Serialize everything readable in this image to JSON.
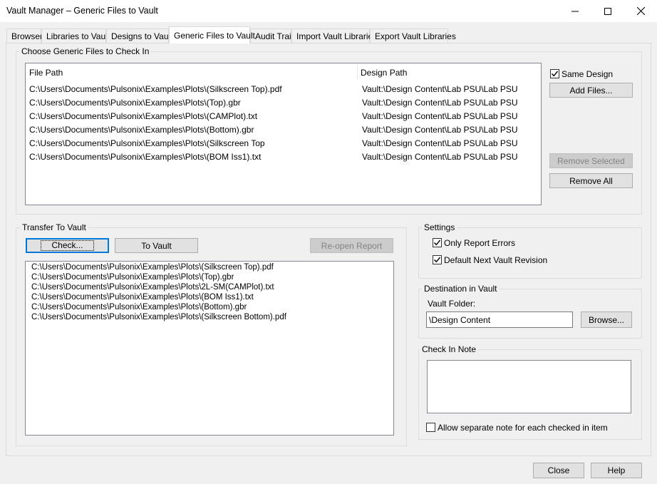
{
  "window": {
    "title": "Vault Manager – Generic Files to Vault",
    "minimize_glyph": "—",
    "maximize_glyph": "☐",
    "close_glyph": "✕"
  },
  "tabs": [
    {
      "label": "Browser",
      "active": false
    },
    {
      "label": "Libraries to Vault",
      "active": false
    },
    {
      "label": "Designs to Vault",
      "active": false
    },
    {
      "label": "Generic Files to Vault",
      "active": true
    },
    {
      "label": "Audit Trail",
      "active": false
    },
    {
      "label": "Import Vault Libraries",
      "active": false
    },
    {
      "label": "Export Vault Libraries",
      "active": false
    }
  ],
  "choose": {
    "group_label": "Choose Generic Files to Check In",
    "col_file_path": "File Path",
    "col_design_path": "Design Path",
    "rows": [
      {
        "file": "C:\\Users\\Documents\\Pulsonix\\Examples\\Plots\\(Silkscreen Top).pdf",
        "design": "Vault:\\Design Content\\Lab PSU\\Lab PSU"
      },
      {
        "file": "C:\\Users\\Documents\\Pulsonix\\Examples\\Plots\\(Top).gbr",
        "design": "Vault:\\Design Content\\Lab PSU\\Lab PSU"
      },
      {
        "file": "C:\\Users\\Documents\\Pulsonix\\Examples\\Plots\\(CAMPlot).txt",
        "design": "Vault:\\Design Content\\Lab PSU\\Lab PSU"
      },
      {
        "file": "C:\\Users\\Documents\\Pulsonix\\Examples\\Plots\\(Bottom).gbr",
        "design": "Vault:\\Design Content\\Lab PSU\\Lab PSU"
      },
      {
        "file": "C:\\Users\\Documents\\Pulsonix\\Examples\\Plots\\(Silkscreen Top",
        "design": "Vault:\\Design Content\\Lab PSU\\Lab PSU"
      },
      {
        "file": "C:\\Users\\Documents\\Pulsonix\\Examples\\Plots\\(BOM Iss1).txt",
        "design": "Vault:\\Design Content\\Lab PSU\\Lab PSU"
      }
    ],
    "same_design_label": "Same Design",
    "same_design_checked": true,
    "add_files": "Add Files...",
    "remove_selected": "Remove Selected",
    "remove_all": "Remove All"
  },
  "transfer": {
    "group_label": "Transfer To Vault",
    "check": "Check...",
    "to_vault": "To Vault",
    "reopen_report": "Re-open Report",
    "items": [
      "C:\\Users\\Documents\\Pulsonix\\Examples\\Plots\\(Silkscreen Top).pdf",
      "C:\\Users\\Documents\\Pulsonix\\Examples\\Plots\\(Top).gbr",
      "C:\\Users\\Documents\\Pulsonix\\Examples\\Plots\\2L-SM(CAMPlot).txt",
      "C:\\Users\\Documents\\Pulsonix\\Examples\\Plots\\(BOM Iss1).txt",
      "C:\\Users\\Documents\\Pulsonix\\Examples\\Plots\\(Bottom).gbr",
      "C:\\Users\\Documents\\Pulsonix\\Examples\\Plots\\(Silkscreen Bottom).pdf"
    ]
  },
  "settings": {
    "group_label": "Settings",
    "only_report_errors": "Only Report Errors",
    "only_report_errors_checked": true,
    "default_next_revision": "Default Next Vault Revision",
    "default_next_revision_checked": true
  },
  "destination": {
    "group_label": "Destination in Vault",
    "folder_label": "Vault Folder:",
    "folder_value": "\\Design Content",
    "browse": "Browse..."
  },
  "checkin_note": {
    "group_label": "Check In Note",
    "allow_separate_label": "Allow separate note for each checked in item",
    "allow_separate_checked": false
  },
  "footer": {
    "close": "Close",
    "help": "Help"
  },
  "colors": {
    "window_bg": "#f0f0f0",
    "accent_focus": "#0078d7",
    "disabled_text": "#838383"
  }
}
